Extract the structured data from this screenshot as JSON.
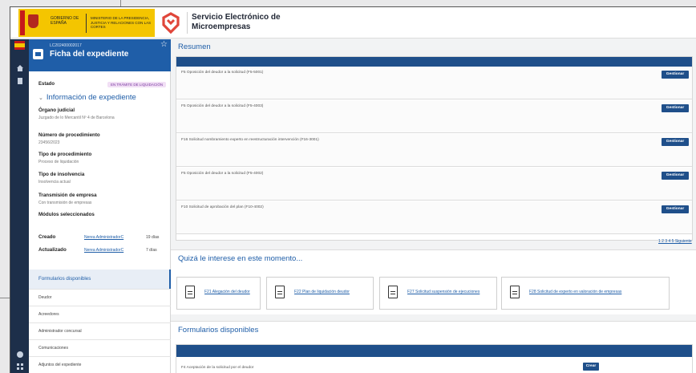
{
  "header": {
    "gov_line1": "GOBIERNO DE ESPAÑA",
    "gov_line2": "MINISTERIO DE LA PRESIDENCIA, JUSTICIA Y RELACIONES CON LAS CORTES",
    "app_name": "Servicio Electrónico de Microempresas",
    "brand_color": "#1f5ea8",
    "accent_red": "#c61a1a"
  },
  "rail": {
    "icons": [
      "spain-flag-icon",
      "home-icon",
      "document-icon",
      "user-icon",
      "grid-icon"
    ]
  },
  "expediente": {
    "code": "LC202400002017",
    "title": "Ficha del expediente"
  },
  "estado": {
    "label": "Estado",
    "value": "EN TRÁMITE DE LIQUIDACIÓN"
  },
  "info": {
    "heading": "Información de expediente",
    "fields": [
      {
        "label": "Órgano judicial",
        "value": "Juzgado de lo Mercantil Nº 4 de Barcelona"
      },
      {
        "label": "Número de procedimiento",
        "value": "23456/2023"
      },
      {
        "label": "Tipo de procedimiento",
        "value": "Proceso de liquidación"
      },
      {
        "label": "Tipo de insolvencia",
        "value": "Insolvencia actual"
      },
      {
        "label": "Transmisión de empresa",
        "value": "Con transmisión de empresas"
      },
      {
        "label": "Módulos seleccionados",
        "value": ""
      }
    ]
  },
  "meta": {
    "created_label": "Creado",
    "created_by": "Nerea AdministradorC",
    "created_ago": "19 días",
    "updated_label": "Actualizado",
    "updated_by": "Nerea AdministradorC",
    "updated_ago": "7 días"
  },
  "nav": {
    "active": "Formularios disponibles",
    "items": [
      "Deudor",
      "Acreedores",
      "Administrador concursal",
      "Comunicaciones",
      "Adjuntos del expediente"
    ]
  },
  "resumen": {
    "title": "Resumen",
    "rows": [
      {
        "label": "F5 Oposición del deudor a la solicitud (F5-5001)",
        "action": "Gestionar"
      },
      {
        "label": "F5 Oposición del deudor a la solicitud (F5-4003)",
        "action": "Gestionar"
      },
      {
        "label": "F16 Solicitud nombramiento experto en reestructuración intervención (F16-3001)",
        "action": "Gestionar"
      },
      {
        "label": "F5 Oposición del deudor a la solicitud (F5-4002)",
        "action": "Gestionar"
      },
      {
        "label": "F10 Solicitud de aprobación del plan (F10-4002)",
        "action": "Gestionar"
      }
    ],
    "pager": "1 2 3 4 5 Siguiente"
  },
  "interest": {
    "title": "Quizá le interese en este momento...",
    "cards": [
      "F21 Alegación del deudor",
      "F22 Plan de liquidación deudor",
      "F27 Solicitud suspensión de ejecuciones",
      "F28 Solicitud de experto en valoración de empresas"
    ]
  },
  "forms": {
    "title": "Formularios disponibles",
    "rows": [
      {
        "label": "F4 Aceptación de la solicitud por el deudor",
        "action": "Crear"
      }
    ]
  }
}
